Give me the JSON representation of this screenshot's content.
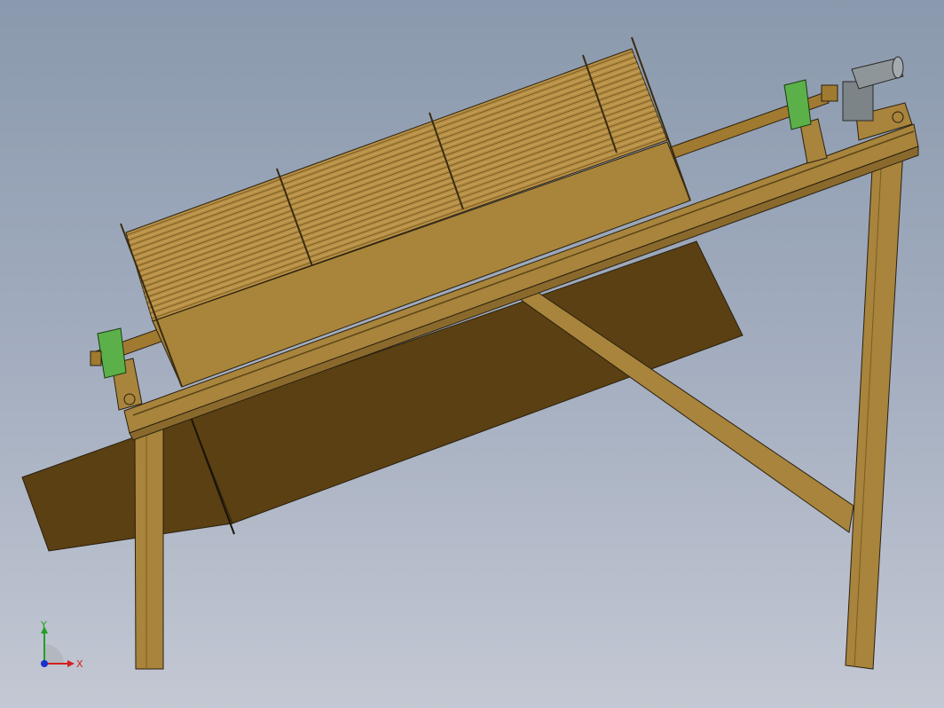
{
  "view": {
    "title": "",
    "background_top": "#8a99ad",
    "background_bottom": "#c3c8d3"
  },
  "model": {
    "name": "",
    "colors": {
      "frame": "#a8843c",
      "frame_dark": "#8a6a2c",
      "chute": "#5a4012",
      "drum": "#a8853a",
      "bearing": "#5bb04a",
      "motor": "#8f9699",
      "edge": "#2a2010"
    }
  },
  "triad": {
    "x_label": "X",
    "y_label": "Y",
    "x_color": "#d42020",
    "y_color": "#22a022",
    "z_color": "#1a2fd0"
  }
}
